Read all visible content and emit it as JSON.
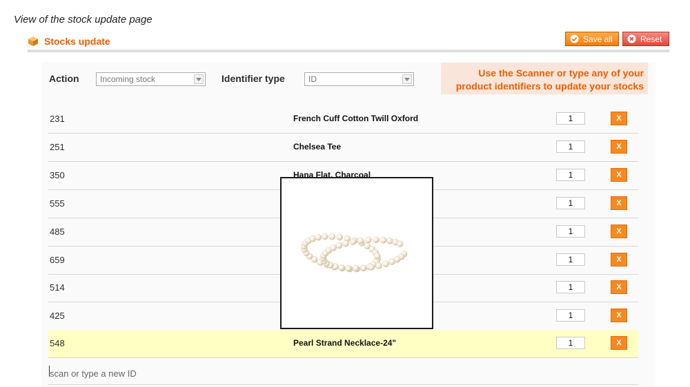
{
  "caption": "View of the stock update page",
  "header": {
    "title": "Stocks update",
    "icon": "box-icon",
    "accent": "#eb5e00"
  },
  "toolbar": {
    "save_label": "Save all",
    "reset_label": "Reset"
  },
  "form": {
    "action_label": "Action",
    "action_value": "Incoming stock",
    "identifier_label": "Identifier type",
    "identifier_value": "ID",
    "notice": "Use the Scanner or type any of your product identifiers to update your stocks"
  },
  "rows": [
    {
      "id": "231",
      "name": "French Cuff Cotton Twill Oxford",
      "qty": "1",
      "remove": "X"
    },
    {
      "id": "251",
      "name": "Chelsea Tee",
      "qty": "1",
      "remove": "X"
    },
    {
      "id": "350",
      "name": "Hana Flat, Charcoal",
      "qty": "1",
      "remove": "X"
    },
    {
      "id": "555",
      "name": "",
      "qty": "1",
      "remove": "X"
    },
    {
      "id": "485",
      "name": "",
      "qty": "1",
      "remove": "X"
    },
    {
      "id": "659",
      "name": "",
      "qty": "1",
      "remove": "X"
    },
    {
      "id": "514",
      "name": "",
      "qty": "1",
      "remove": "X"
    },
    {
      "id": "425",
      "name": "",
      "qty": "1",
      "remove": "X"
    },
    {
      "id": "548",
      "name": "Pearl Strand Necklace-24\"",
      "qty": "1",
      "remove": "X"
    }
  ],
  "scan": {
    "placeholder": "scan or type a new ID"
  },
  "popup": {
    "image": "pearl-necklace-image"
  }
}
